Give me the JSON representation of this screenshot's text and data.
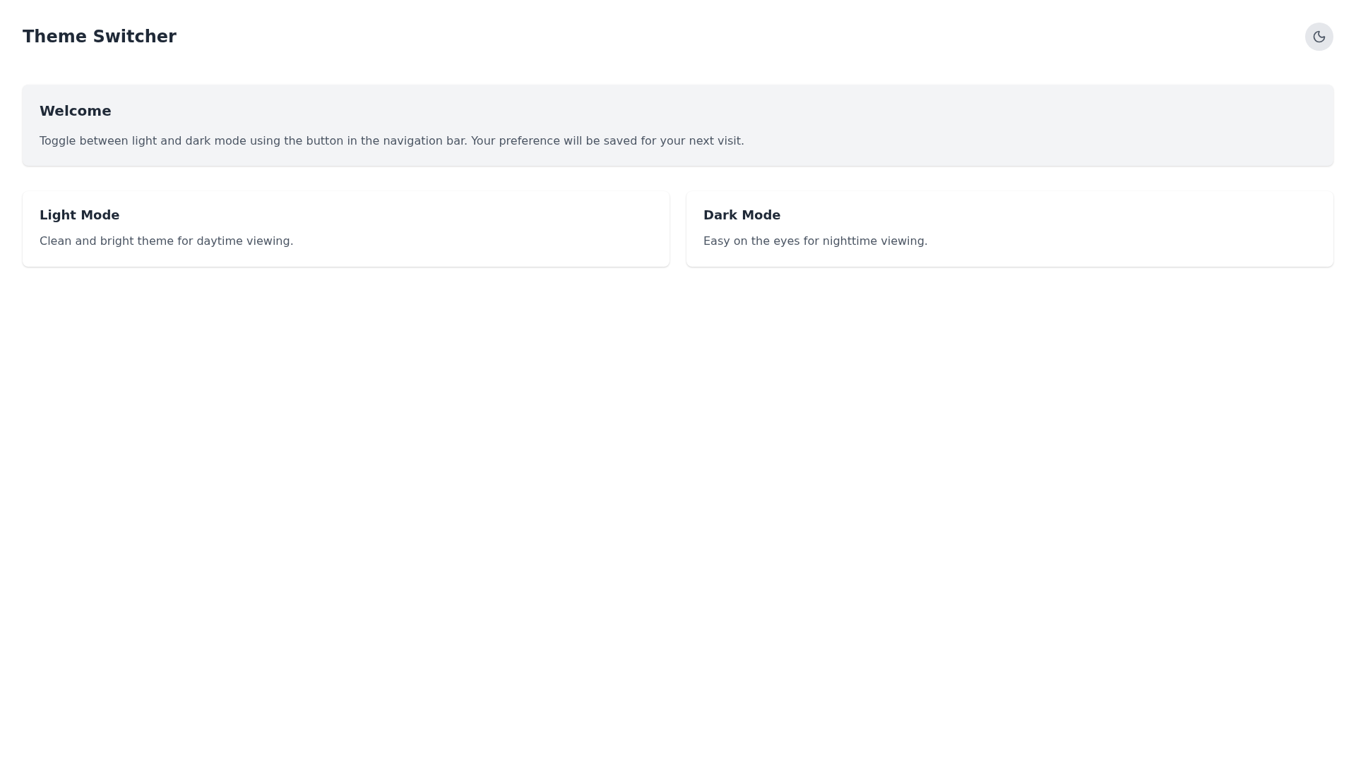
{
  "header": {
    "title": "Theme Switcher",
    "theme_toggle": {
      "dark": false
    }
  },
  "welcome": {
    "heading": "Welcome",
    "text": "Toggle between light and dark mode using the button in the navigation bar. Your preference will be saved for your next visit."
  },
  "cards": [
    {
      "title": "Light Mode",
      "text": "Clean and bright theme for daytime viewing."
    },
    {
      "title": "Dark Mode",
      "text": "Easy on the eyes for nighttime viewing."
    }
  ]
}
